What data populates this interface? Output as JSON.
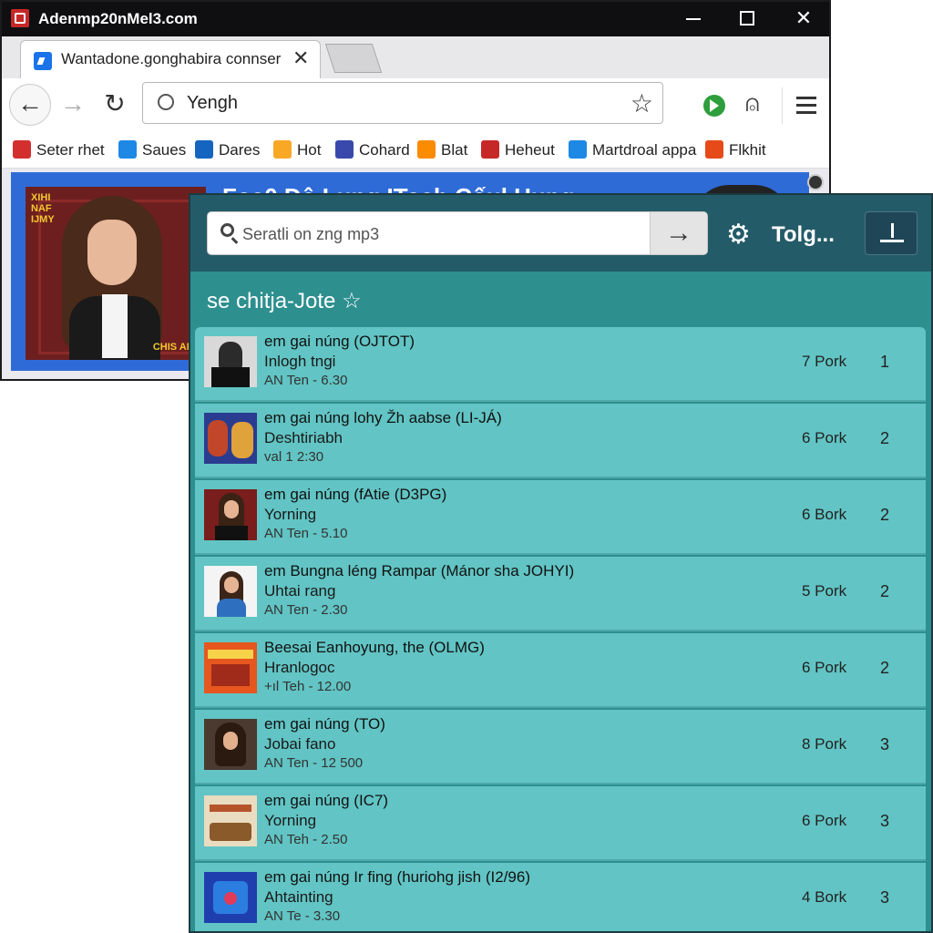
{
  "window": {
    "title": "Adenmp20nMel3.com"
  },
  "tab": {
    "title": "Wantadone.gonghabira connser"
  },
  "address_bar": {
    "text": "Yengh"
  },
  "bookmarks": [
    {
      "label": "Seter rhet",
      "color": "#d32f2f"
    },
    {
      "label": "Saues",
      "color": "#1e88e5"
    },
    {
      "label": "Dares",
      "color": "#1565c0"
    },
    {
      "label": "Hot",
      "color": "#f9a825"
    },
    {
      "label": "Cohard",
      "color": "#3949ab"
    },
    {
      "label": "Blat",
      "color": "#fb8c00"
    },
    {
      "label": "Heheut",
      "color": "#c62828"
    },
    {
      "label": "Martdroal appa",
      "color": "#1e88e5"
    },
    {
      "label": "Flkhit",
      "color": "#e64a19"
    }
  ],
  "page": {
    "hero_heading": "Foa0 Dô Lung IToah Cốul Hung",
    "hero_tag_top": "XIHI NAF IJMY",
    "hero_tag_bottom": "CHIS ANS"
  },
  "music_panel": {
    "search_placeholder": "Seratli on zng mp3",
    "toggle_label": "Tolg...",
    "playlist_title": "se chitja-Jote ☆",
    "tracks": [
      {
        "title": "em gai núng (OJTOT)",
        "artist": "Inlogh tngi",
        "meta": "AN Ten - 6.30",
        "plays": "7 Pork",
        "num": "1"
      },
      {
        "title": "em gai núng lohy Žh aabse (LI-JÁ)",
        "artist": "Deshtiriabh",
        "meta": "val 1 2:30",
        "plays": "6 Pork",
        "num": "2"
      },
      {
        "title": "em gai núng (fAtie (D3PG)",
        "artist": "Yorning",
        "meta": "AN Ten - 5.10",
        "plays": "6 Bork",
        "num": "2"
      },
      {
        "title": "em Bungna léng Rampar (Mánor sha JOHYI)",
        "artist": "Uhtai rang",
        "meta": "AN Ten - 2.30",
        "plays": "5 Pork",
        "num": "2"
      },
      {
        "title": "Beesai Eanhoyung, the (OLMG)",
        "artist": "Hranlogoc",
        "meta": "+ıl Teh - 12.00",
        "plays": "6 Pork",
        "num": "2"
      },
      {
        "title": "em gai núng (TO)",
        "artist": "Jobai fano",
        "meta": "AN Ten - 12 500",
        "plays": "8 Pork",
        "num": "3"
      },
      {
        "title": "em gai núng (IC7)",
        "artist": "Yorning",
        "meta": "AN Teh - 2.50",
        "plays": "6 Pork",
        "num": "3"
      },
      {
        "title": "em gai núng Ir fing (huriohg jish (I2/96)",
        "artist": "Ahtainting",
        "meta": "AN Te - 3.30",
        "plays": "4 Bork",
        "num": "3"
      }
    ]
  }
}
